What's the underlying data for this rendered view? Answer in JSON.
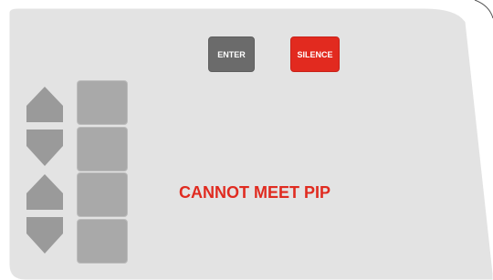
{
  "buttons": {
    "enter_label": "ENTER",
    "silence_label": "SILENCE"
  },
  "message": {
    "text": "CANNOT MEET PIP"
  },
  "colors": {
    "panel": "#e3e3e3",
    "enter": "#6b6b6b",
    "silence": "#e22a1f",
    "message": "#e02b20",
    "soft_key": "#a9a9a9",
    "arrow": "#9a9a9a"
  },
  "icons": {
    "up_arrow": "up-arrow-icon",
    "down_arrow": "down-arrow-icon"
  }
}
